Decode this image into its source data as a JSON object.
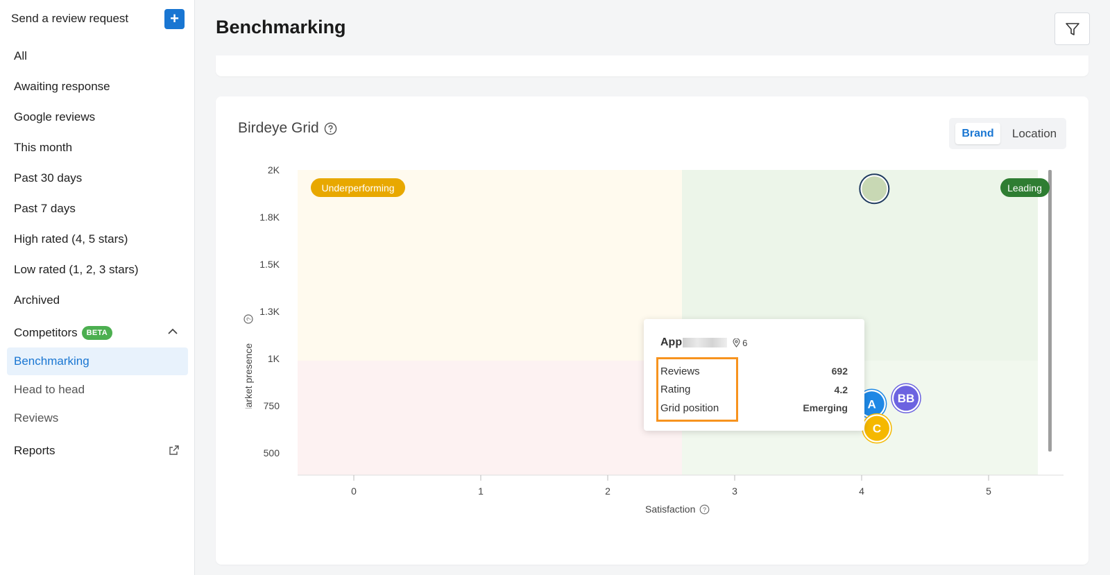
{
  "sidebar": {
    "top_label": "Send a review request",
    "plus": "+",
    "items": [
      "All",
      "Awaiting response",
      "Google reviews",
      "This month",
      "Past 30 days",
      "Past 7 days",
      "High rated (4, 5 stars)",
      "Low rated (1, 2, 3 stars)",
      "Archived"
    ],
    "competitors": {
      "label": "Competitors",
      "badge": "BETA"
    },
    "sub_items": [
      "Benchmarking",
      "Head to head",
      "Reviews"
    ],
    "reports": "Reports"
  },
  "header": {
    "title": "Benchmarking"
  },
  "grid": {
    "title": "Birdeye Grid",
    "toggle": {
      "brand": "Brand",
      "location": "Location",
      "selected": "Brand"
    }
  },
  "chart_data": {
    "type": "scatter",
    "xlabel": "Satisfaction",
    "ylabel": "Market presence",
    "x_ticks": [
      "0",
      "1",
      "2",
      "3",
      "4",
      "5"
    ],
    "y_ticks": [
      "500",
      "750",
      "1K",
      "1.3K",
      "1.5K",
      "1.8K",
      "2K"
    ],
    "xlim": [
      -0.5,
      5.5
    ],
    "quadrant_labels": {
      "top_left": "Underperforming",
      "top_right": "Leading"
    },
    "points": [
      {
        "label": "",
        "x": 4.1,
        "y": 1920,
        "color": "#c8d8b4",
        "border": "#1f3a5f"
      },
      {
        "label": "BB",
        "x": 4.35,
        "y": 790,
        "color": "#6c63e0"
      },
      {
        "label": "A",
        "x": 4.08,
        "y": 760,
        "color": "#1e88e5"
      },
      {
        "label": "C",
        "x": 4.12,
        "y": 630,
        "color": "#f5b800"
      }
    ]
  },
  "tooltip": {
    "name_prefix": "App",
    "locations": "6",
    "rows": [
      {
        "label": "Reviews",
        "value": "692"
      },
      {
        "label": "Rating",
        "value": "4.2"
      },
      {
        "label": "Grid position",
        "value": "Emerging"
      }
    ]
  },
  "colors": {
    "accent": "#1976d2",
    "beta": "#4caf50",
    "highlight": "#f7931e",
    "underperforming": "#e8a800",
    "leading": "#2e7d32"
  }
}
